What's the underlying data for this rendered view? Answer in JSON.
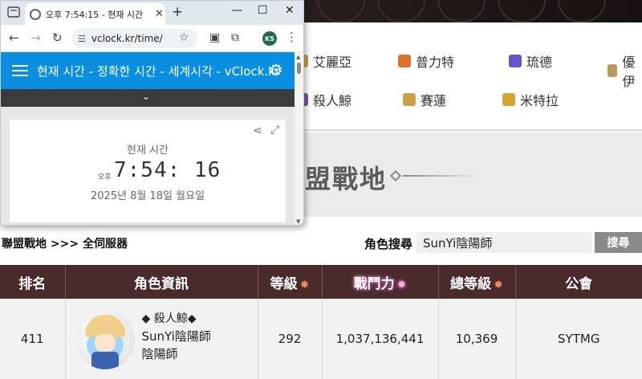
{
  "background_page": {
    "servers_row1": [
      {
        "name": "艾麗亞",
        "icon": "aria-world-icon",
        "color": "#c9a04a"
      },
      {
        "name": "普力特",
        "icon": "pollit-world-icon",
        "color": "#d8742c"
      },
      {
        "name": "琉德",
        "icon": "luna-world-icon",
        "color": "#6a54c8"
      },
      {
        "name": "優伊",
        "icon": "elysium-world-icon",
        "color": "#b89a5a"
      }
    ],
    "servers_row2": [
      {
        "name": "殺人鯨",
        "icon": "orca-world-icon",
        "color": "#7a5a9a"
      },
      {
        "name": "賽蓮",
        "icon": "siren-world-icon",
        "color": "#c9a04a"
      },
      {
        "name": "米特拉",
        "icon": "mitra-world-icon",
        "color": "#d4a530"
      }
    ],
    "hero_title": "盟戰地",
    "breadcrumb": "聯盟戰地 >>> 全伺服器",
    "search": {
      "label": "角色搜尋",
      "value": "SunYi陰陽師",
      "button": "搜尋"
    },
    "table": {
      "headers": [
        "排名",
        "角色資訊",
        "等級",
        "戰鬥力",
        "總等級",
        "公會"
      ],
      "rows": [
        {
          "rank": "411",
          "server": "◆ 殺人鯨◆",
          "name": "SunYi陰陽師",
          "job": "陰陽師",
          "level": "292",
          "power": "1,037,136,441",
          "total_level": "10,369",
          "guild": "SYTMG"
        }
      ]
    },
    "colors": {
      "header_bg": "#4a2a2a",
      "row_bg": "#f2f2f2"
    }
  },
  "popup": {
    "tab_title": "오후 7:54:15 - 현재 시간",
    "new_tab": "+",
    "window_controls": {
      "minimize": "—",
      "maximize": "☐",
      "close": "✕"
    },
    "url": "vclock.kr/time/",
    "profile_initials": "KS",
    "site_title": "현재 시간 - 정확한 시간 - 세계시각 - vClock.kr",
    "clock": {
      "label": "현재 시간",
      "ampm": "오후",
      "time": "7:54: 16",
      "date": "2025년 8월 18일 월요일"
    },
    "accent": "#0a8ee0"
  }
}
